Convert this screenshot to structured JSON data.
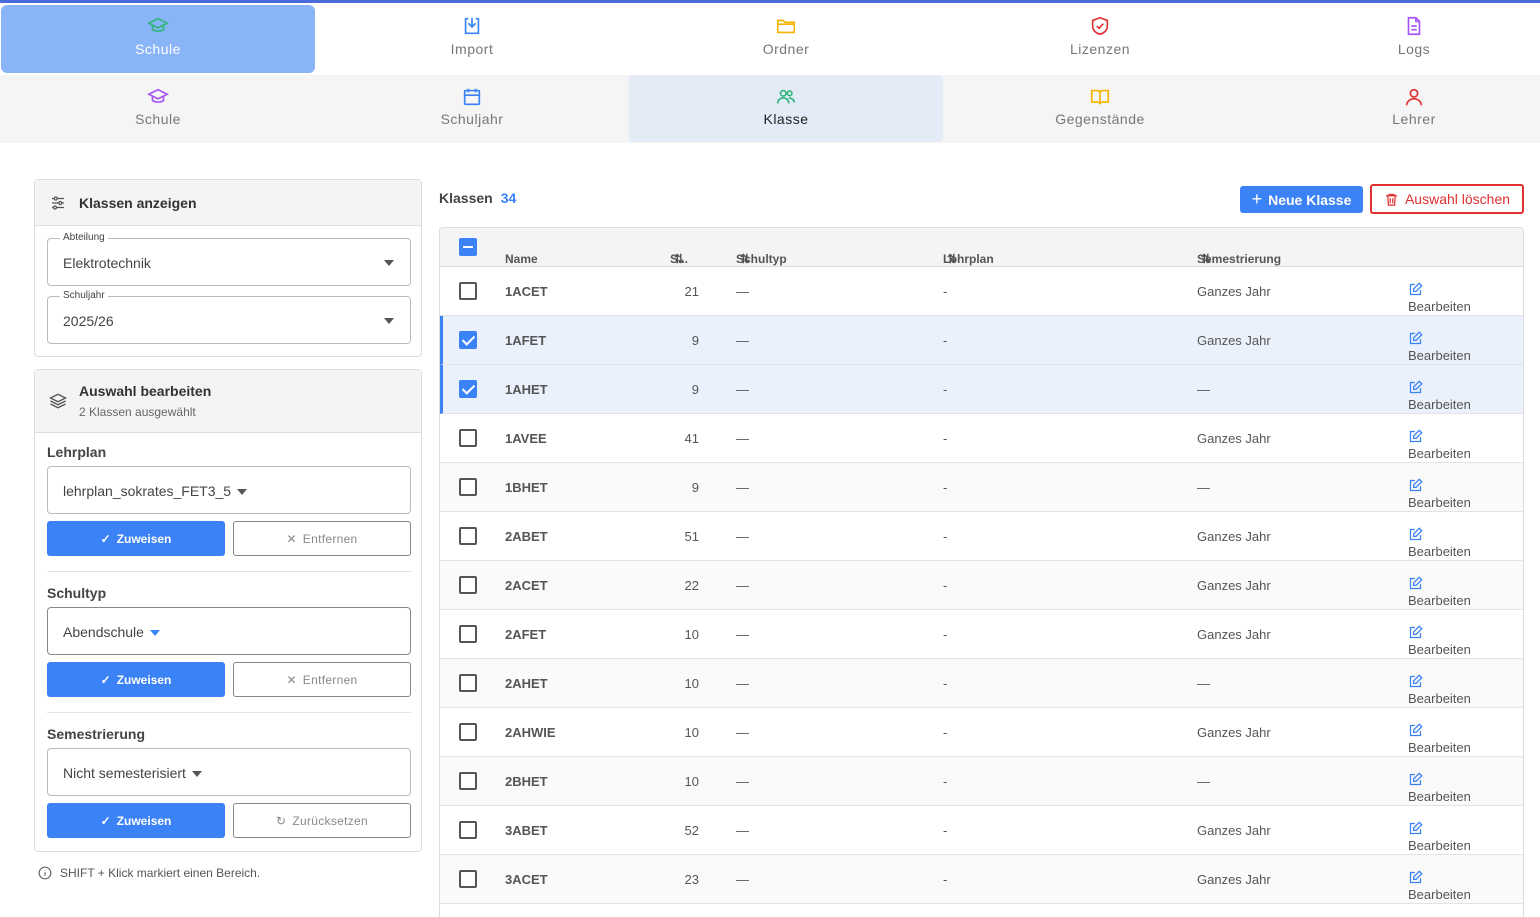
{
  "top_tabs": [
    {
      "label": "Schule",
      "icon": "graduation-cap-icon",
      "active": true
    },
    {
      "label": "Import",
      "icon": "download-icon"
    },
    {
      "label": "Ordner",
      "icon": "folder-icon"
    },
    {
      "label": "Lizenzen",
      "icon": "shield-check-icon"
    },
    {
      "label": "Logs",
      "icon": "file-text-icon"
    }
  ],
  "sub_tabs": [
    {
      "label": "Schule",
      "icon": "graduation-cap-icon"
    },
    {
      "label": "Schuljahr",
      "icon": "calendar-icon"
    },
    {
      "label": "Klasse",
      "icon": "users-icon",
      "active": true
    },
    {
      "label": "Gegenstände",
      "icon": "book-open-icon"
    },
    {
      "label": "Lehrer",
      "icon": "user-icon"
    }
  ],
  "filter_panel": {
    "title": "Klassen anzeigen",
    "abteilung_label": "Abteilung",
    "abteilung_value": "Elektrotechnik",
    "schuljahr_label": "Schuljahr",
    "schuljahr_value": "2025/26"
  },
  "edit_panel": {
    "title": "Auswahl bearbeiten",
    "subtitle": "2 Klassen ausgewählt",
    "lehrplan_label": "Lehrplan",
    "lehrplan_value": "lehrplan_sokrates_FET3_5",
    "schultyp_label": "Schultyp",
    "schultyp_value": "Abendschule",
    "semestrierung_label": "Semestrierung",
    "semestrierung_value": "Nicht semesterisiert",
    "assign_label": "Zuweisen",
    "remove_label": "Entfernen",
    "reset_label": "Zurücksetzen"
  },
  "hint": "SHIFT + Klick markiert einen Bereich.",
  "table": {
    "title": "Klassen",
    "count": "34",
    "new_button": "Neue Klasse",
    "delete_button": "Auswahl löschen",
    "columns": [
      "Name",
      "S...",
      "Schultyp",
      "Lehrplan",
      "Semestrierung"
    ],
    "edit_label": "Bearbeiten",
    "rows": [
      {
        "name": "1ACET",
        "s": "21",
        "schultyp": "—",
        "lehrplan": "-",
        "sem": "Ganzes Jahr",
        "checked": false
      },
      {
        "name": "1AFET",
        "s": "9",
        "schultyp": "—",
        "lehrplan": "-",
        "sem": "Ganzes Jahr",
        "checked": true
      },
      {
        "name": "1AHET",
        "s": "9",
        "schultyp": "—",
        "lehrplan": "-",
        "sem": "—",
        "checked": true
      },
      {
        "name": "1AVEE",
        "s": "41",
        "schultyp": "—",
        "lehrplan": "-",
        "sem": "Ganzes Jahr",
        "checked": false
      },
      {
        "name": "1BHET",
        "s": "9",
        "schultyp": "—",
        "lehrplan": "-",
        "sem": "—",
        "checked": false
      },
      {
        "name": "2ABET",
        "s": "51",
        "schultyp": "—",
        "lehrplan": "-",
        "sem": "Ganzes Jahr",
        "checked": false
      },
      {
        "name": "2ACET",
        "s": "22",
        "schultyp": "—",
        "lehrplan": "-",
        "sem": "Ganzes Jahr",
        "checked": false
      },
      {
        "name": "2AFET",
        "s": "10",
        "schultyp": "—",
        "lehrplan": "-",
        "sem": "Ganzes Jahr",
        "checked": false
      },
      {
        "name": "2AHET",
        "s": "10",
        "schultyp": "—",
        "lehrplan": "-",
        "sem": "—",
        "checked": false
      },
      {
        "name": "2AHWIE",
        "s": "10",
        "schultyp": "—",
        "lehrplan": "-",
        "sem": "Ganzes Jahr",
        "checked": false
      },
      {
        "name": "2BHET",
        "s": "10",
        "schultyp": "—",
        "lehrplan": "-",
        "sem": "—",
        "checked": false
      },
      {
        "name": "3ABET",
        "s": "52",
        "schultyp": "—",
        "lehrplan": "-",
        "sem": "Ganzes Jahr",
        "checked": false
      },
      {
        "name": "3ACET",
        "s": "23",
        "schultyp": "—",
        "lehrplan": "-",
        "sem": "Ganzes Jahr",
        "checked": false
      }
    ]
  },
  "colors": {
    "accent": "#3b82f6",
    "danger": "#e03030",
    "active_tab": "#8ab4f8"
  }
}
